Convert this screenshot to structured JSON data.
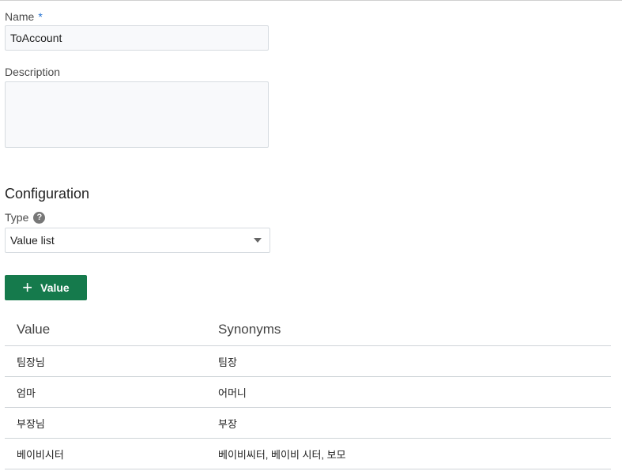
{
  "form": {
    "name_label": "Name",
    "name_required_mark": "*",
    "name_value": "ToAccount",
    "description_label": "Description",
    "description_value": ""
  },
  "configuration": {
    "title": "Configuration",
    "type_label": "Type",
    "help_icon_glyph": "?",
    "type_selected": "Value list",
    "add_button_icon": "+",
    "add_button_label": "Value"
  },
  "table": {
    "headers": [
      "Value",
      "Synonyms"
    ],
    "rows": [
      {
        "value": "팀장님",
        "synonyms": "팀장"
      },
      {
        "value": "엄마",
        "synonyms": "어머니"
      },
      {
        "value": "부장님",
        "synonyms": "부장"
      },
      {
        "value": "베이비시터",
        "synonyms": "베이비씨터, 베이비 시터, 보모"
      }
    ]
  },
  "colors": {
    "primary_button": "#157a4c",
    "required_mark": "#1f6fd1"
  }
}
